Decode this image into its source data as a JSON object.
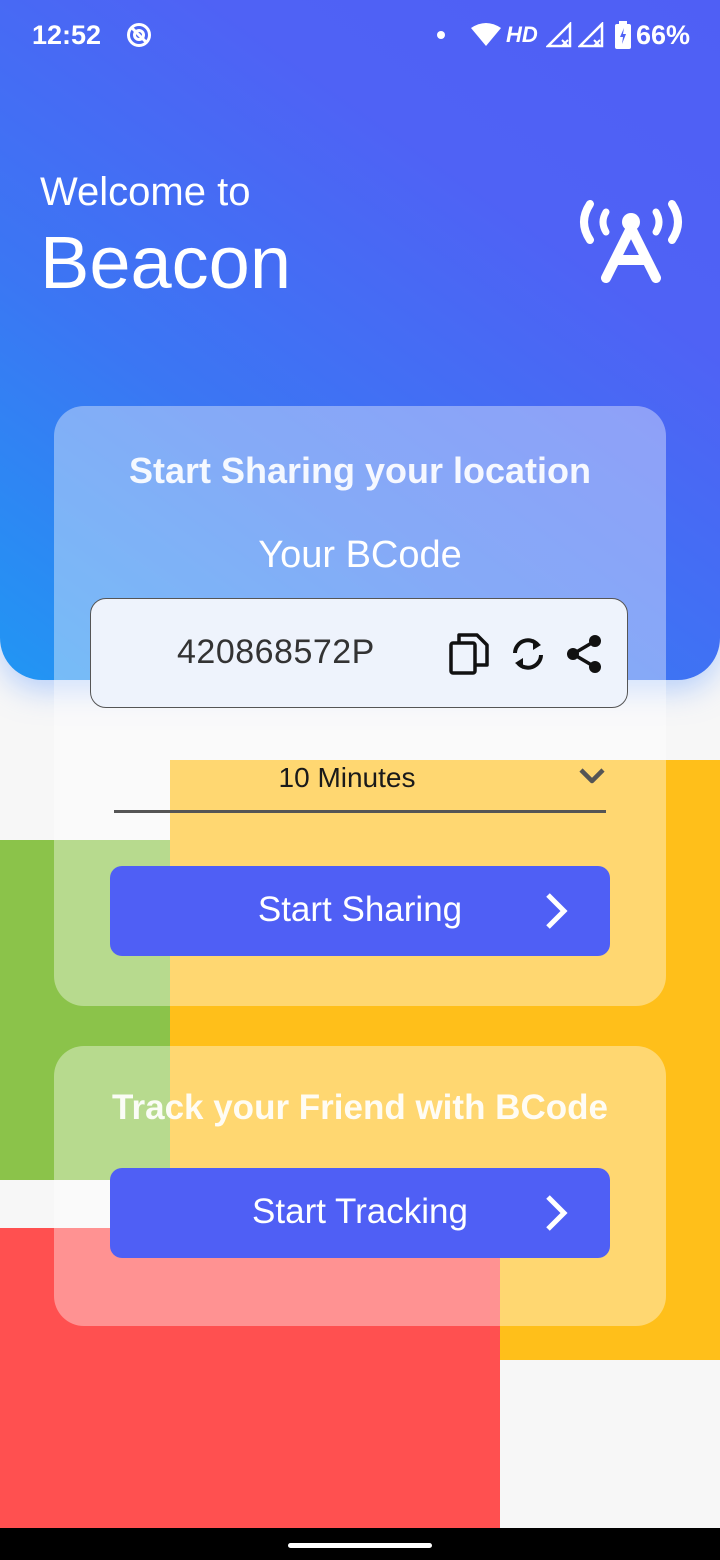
{
  "status_bar": {
    "time": "12:52",
    "network_label": "HD",
    "battery": "66%",
    "icons": [
      "vpn-icon",
      "wifi-icon",
      "signal-icon",
      "signal-icon",
      "battery-icon"
    ]
  },
  "header": {
    "welcome": "Welcome to",
    "app_name": "Beacon",
    "logo_icon": "beacon-antenna-icon"
  },
  "share_card": {
    "title": "Start Sharing your location",
    "bcode_label": "Your BCode",
    "bcode": "420868572P",
    "actions": [
      "copy-icon",
      "refresh-icon",
      "share-icon"
    ],
    "duration": {
      "selected": "10 Minutes"
    },
    "button_label": "Start Sharing"
  },
  "track_card": {
    "title": "Track your Friend with BCode",
    "button_label": "Start Tracking"
  },
  "colors": {
    "primary": "#4f5ff5",
    "header_gradient_start": "#2196f3",
    "green": "#8bc34a",
    "yellow": "#ffbf1a",
    "red": "#ff5050"
  }
}
